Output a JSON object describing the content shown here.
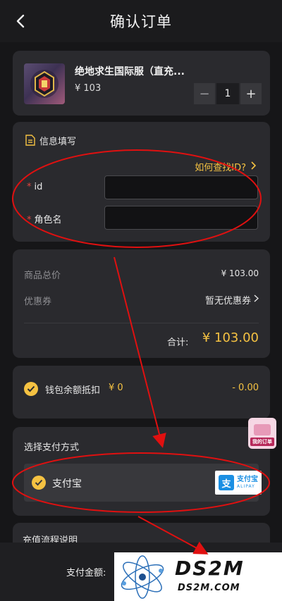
{
  "header": {
    "title": "确认订单"
  },
  "product": {
    "name": "绝地求生国际服（直充...",
    "price": "¥ 103",
    "quantity": "1",
    "minus": "−",
    "plus": "+"
  },
  "info": {
    "title": "信息填写",
    "find_id_link": "如何查找ID?",
    "fields": [
      {
        "required": "*",
        "label": "id",
        "value": ""
      },
      {
        "required": "*",
        "label": "角色名",
        "value": ""
      }
    ]
  },
  "totals": {
    "goods_label": "商品总价",
    "goods_value": "¥ 103.00",
    "coupon_label": "优惠券",
    "coupon_value": "暂无优惠券",
    "sum_label": "合计:",
    "sum_value": "¥ 103.00"
  },
  "wallet": {
    "label": "钱包余额抵扣",
    "balance": "¥ 0",
    "deduction": "- 0.00",
    "checked": true
  },
  "payment": {
    "title": "选择支付方式",
    "option": "支付宝",
    "logo_cn": "支付宝",
    "logo_en": "ALIPAY",
    "logo_mark": "支"
  },
  "process": {
    "title": "充值流程说明"
  },
  "bottom": {
    "pay_total_label": "支付金额:"
  },
  "floating": {
    "my_orders": "我的订单"
  },
  "watermark": {
    "main": "DS2M",
    "sub": "DS2M.COM"
  },
  "colors": {
    "accent": "#f5c242",
    "required": "#e0463f",
    "annotation": "#e01010",
    "card": "#2a2a2e",
    "background": "#161618"
  }
}
